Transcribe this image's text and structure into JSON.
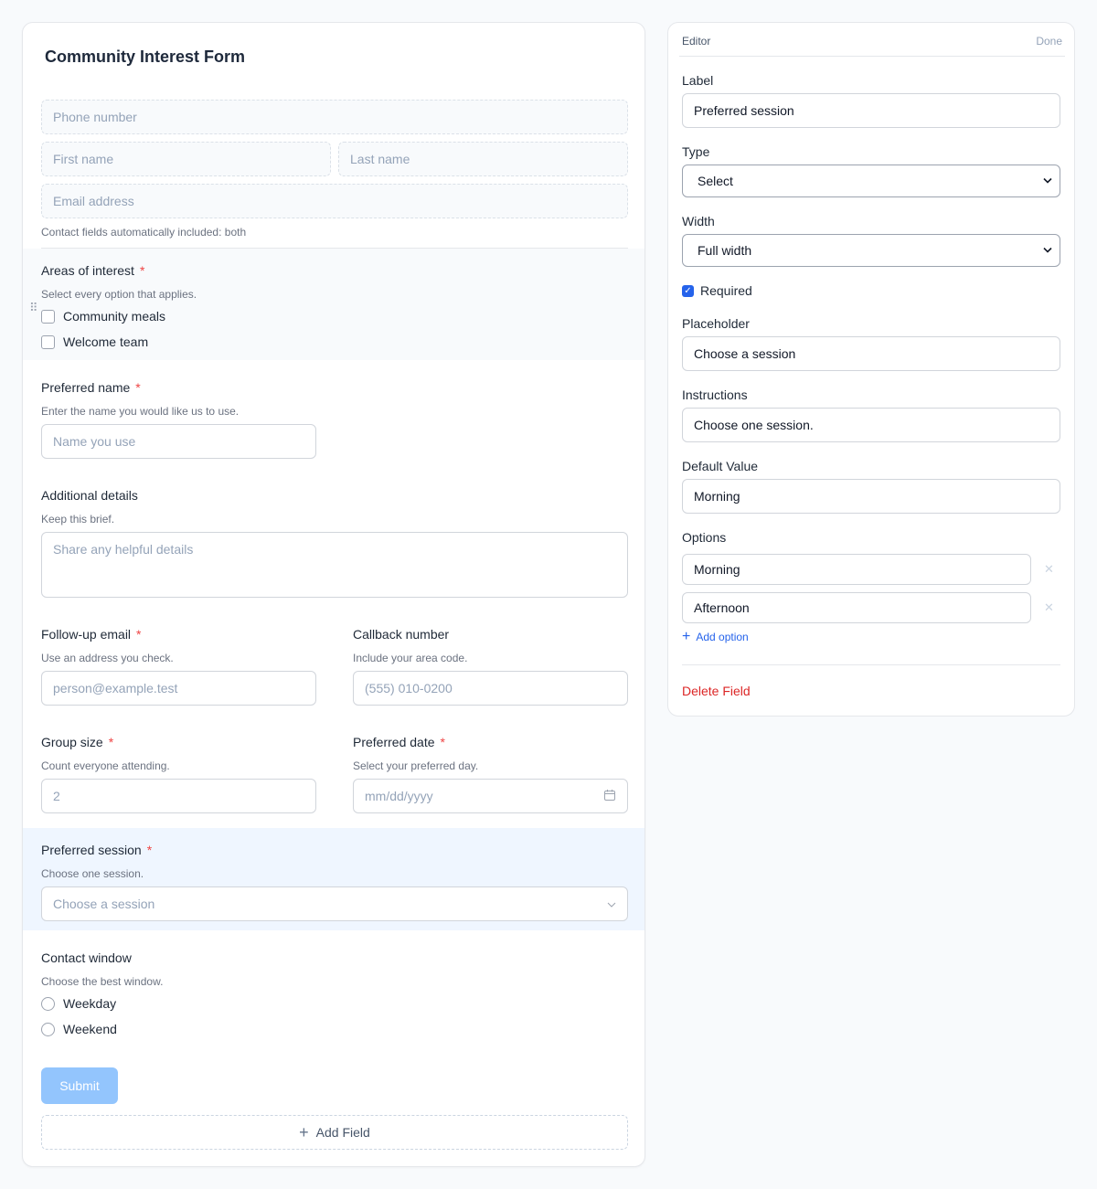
{
  "form": {
    "title": "Community Interest Form",
    "contact_fields": {
      "phone_placeholder": "Phone number",
      "first_name_placeholder": "First name",
      "last_name_placeholder": "Last name",
      "email_placeholder": "Email address",
      "note": "Contact fields automatically included: both"
    },
    "fields": {
      "areas": {
        "label": "Areas of interest",
        "required_mark": "*",
        "help": "Select every option that applies.",
        "options": [
          "Community meals",
          "Welcome team"
        ]
      },
      "preferred_name": {
        "label": "Preferred name",
        "required_mark": "*",
        "help": "Enter the name you would like us to use.",
        "placeholder": "Name you use"
      },
      "additional_details": {
        "label": "Additional details",
        "help": "Keep this brief.",
        "placeholder": "Share any helpful details"
      },
      "followup_email": {
        "label": "Follow-up email",
        "required_mark": "*",
        "help": "Use an address you check.",
        "placeholder": "person@example.test"
      },
      "callback_number": {
        "label": "Callback number",
        "help": "Include your area code.",
        "placeholder": "(555) 010-0200"
      },
      "group_size": {
        "label": "Group size",
        "required_mark": "*",
        "help": "Count everyone attending.",
        "placeholder": "2"
      },
      "preferred_date": {
        "label": "Preferred date",
        "required_mark": "*",
        "help": "Select your preferred day.",
        "placeholder": "mm/dd/yyyy"
      },
      "preferred_session": {
        "label": "Preferred session",
        "required_mark": "*",
        "help": "Choose one session.",
        "placeholder": "Choose a session"
      },
      "contact_window": {
        "label": "Contact window",
        "help": "Choose the best window.",
        "options": [
          "Weekday",
          "Weekend"
        ]
      }
    },
    "submit_label": "Submit",
    "add_field_label": "Add Field"
  },
  "editor": {
    "title": "Editor",
    "done_label": "Done",
    "label_label": "Label",
    "label_value": "Preferred session",
    "type_label": "Type",
    "type_value": "Select",
    "width_label": "Width",
    "width_value": "Full width",
    "required_label": "Required",
    "required_checked": true,
    "placeholder_label": "Placeholder",
    "placeholder_value": "Choose a session",
    "instructions_label": "Instructions",
    "instructions_value": "Choose one session.",
    "default_label": "Default Value",
    "default_value": "Morning",
    "options_label": "Options",
    "options": [
      "Morning",
      "Afternoon"
    ],
    "add_option_label": "Add option",
    "delete_label": "Delete Field"
  },
  "colors": {
    "accent": "#2563eb",
    "required": "#ef4444",
    "delete": "#dc2626",
    "submit_disabled": "#93c5fd",
    "selected_section_bg": "#eff6ff"
  }
}
